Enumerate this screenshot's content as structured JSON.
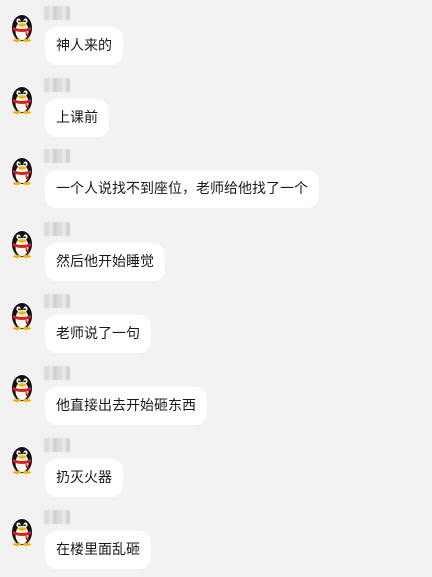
{
  "messages": [
    {
      "text": "神人来的",
      "avatar_icon": "qq-penguin-icon"
    },
    {
      "text": "上课前",
      "avatar_icon": "qq-penguin-icon"
    },
    {
      "text": "一个人说找不到座位，老师给他找了一个",
      "avatar_icon": "qq-penguin-icon"
    },
    {
      "text": "然后他开始睡觉",
      "avatar_icon": "qq-penguin-icon"
    },
    {
      "text": "老师说了一句",
      "avatar_icon": "qq-penguin-icon"
    },
    {
      "text": "他直接出去开始砸东西",
      "avatar_icon": "qq-penguin-icon"
    },
    {
      "text": "扔灭火器",
      "avatar_icon": "qq-penguin-icon"
    },
    {
      "text": "在楼里面乱砸",
      "avatar_icon": "qq-penguin-icon"
    }
  ],
  "colors": {
    "background": "#f2f2f2",
    "bubble": "#ffffff",
    "text": "#1a1a1a",
    "scarf": "#e02020"
  }
}
